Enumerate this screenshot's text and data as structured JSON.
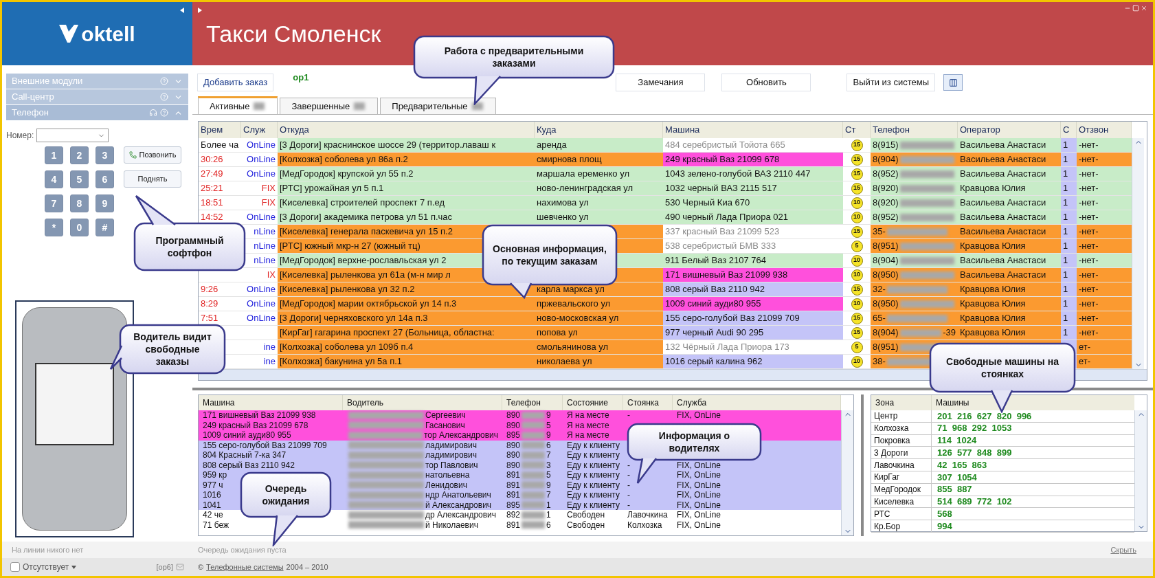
{
  "brand": {
    "logo": "oktell"
  },
  "title_bar": {
    "title": "Такси Смоленск"
  },
  "sidebar": {
    "sections": [
      {
        "label": "Внешние модули",
        "expanded": false
      },
      {
        "label": "Call-центр",
        "expanded": false
      },
      {
        "label": "Телефон",
        "expanded": true
      }
    ]
  },
  "dialer": {
    "number_label": "Номер:",
    "keys": [
      "1",
      "2",
      "3",
      "4",
      "5",
      "6",
      "7",
      "8",
      "9",
      "*",
      "0",
      "#"
    ],
    "call_button": "Позвонить",
    "answer_button": "Поднять"
  },
  "left_status": {
    "line_status": "На линии никого нет",
    "away": {
      "label": "Отсутствует",
      "checked": false
    },
    "operator": "[op6]"
  },
  "toolbar": {
    "add_order": "Добавить заказ",
    "operator": "op1",
    "buttons": [
      "Замечания",
      "Обновить",
      "Выйти из системы"
    ]
  },
  "tabs": [
    {
      "label": "Активные",
      "selected": true
    },
    {
      "label": "Завершенные",
      "selected": false
    },
    {
      "label": "Предварительные",
      "selected": false
    }
  ],
  "orders": {
    "columns": [
      "Врем",
      "Служ",
      "Откуда",
      "Куда",
      "Машина",
      "Ст",
      "Телефон",
      "Оператор",
      "С",
      "Отзвон"
    ],
    "rows": [
      {
        "time": {
          "text": "Более ча",
          "late": false
        },
        "service": {
          "text": "OnLine",
          "color": "#2222dd"
        },
        "route": {
          "from": "[3 Дороги] краснинское шоссе 29 (территор.лаваш к",
          "to": "аренда",
          "color": "#c8ecc8"
        },
        "car": {
          "text": "484 серебристый Тойота 665",
          "dimmed": true,
          "color": "#ffffff"
        },
        "badge": "15",
        "call": {
          "phone": "8(915)",
          "operator": "Васильева Анастаси",
          "recall": "-нет-",
          "color": "#c8ecc8"
        },
        "c": "1"
      },
      {
        "time": {
          "text": "30:26",
          "late": true
        },
        "service": {
          "text": "OnLine",
          "color": "#2222dd"
        },
        "route": {
          "from": "[Колхозка] соболева ул 86а п.2",
          "to": "смирнова площ",
          "color": "#fb9a30"
        },
        "car": {
          "text": "249 красный Ваз 21099 678",
          "dimmed": false,
          "color": "#ff50dc"
        },
        "badge": "15",
        "call": {
          "phone": "8(904)",
          "operator": "Васильева Анастаси",
          "recall": "-нет-",
          "color": "#fb9a30"
        },
        "c": "1"
      },
      {
        "time": {
          "text": "27:49",
          "late": true
        },
        "service": {
          "text": "OnLine",
          "color": "#2222dd"
        },
        "route": {
          "from": "[МедГородок] крупской ул 55 п.2",
          "to": "маршала еременко ул",
          "color": "#c8ecc8"
        },
        "car": {
          "text": "1043 зелено-голубой ВАЗ 2110 447",
          "dimmed": false,
          "color": "#c8ecc8"
        },
        "badge": "15",
        "call": {
          "phone": "8(952)",
          "operator": "Васильева Анастаси",
          "recall": "-нет-",
          "color": "#c8ecc8"
        },
        "c": "1"
      },
      {
        "time": {
          "text": "25:21",
          "late": true
        },
        "service": {
          "text": "FIX",
          "color": "#e02020"
        },
        "route": {
          "from": "[РТС] урожайная ул 5 п.1",
          "to": "ново-ленинградская ул",
          "color": "#c8ecc8"
        },
        "car": {
          "text": "1032 черный ВАЗ 2115 517",
          "dimmed": false,
          "color": "#c8ecc8"
        },
        "badge": "15",
        "call": {
          "phone": "8(920)",
          "operator": "Кравцова Юлия",
          "recall": "-нет-",
          "color": "#c8ecc8"
        },
        "c": "1"
      },
      {
        "time": {
          "text": "18:51",
          "late": true
        },
        "service": {
          "text": "FIX",
          "color": "#e02020"
        },
        "route": {
          "from": "[Киселевка] строителей проспект 7 п.ед",
          "to": "нахимова ул",
          "color": "#c8ecc8"
        },
        "car": {
          "text": "530 Черный Киа 670",
          "dimmed": false,
          "color": "#c8ecc8"
        },
        "badge": "10",
        "call": {
          "phone": "8(920)",
          "operator": "Васильева Анастаси",
          "recall": "-нет-",
          "color": "#c8ecc8"
        },
        "c": "1"
      },
      {
        "time": {
          "text": "14:52",
          "late": true
        },
        "service": {
          "text": "OnLine",
          "color": "#2222dd"
        },
        "route": {
          "from": "[3 Дороги] академика петрова ул 51 п.час",
          "to": "шевченко ул",
          "color": "#c8ecc8"
        },
        "car": {
          "text": "490 черный Лада Приора 021",
          "dimmed": false,
          "color": "#c8ecc8"
        },
        "badge": "10",
        "call": {
          "phone": "8(952)",
          "operator": "Васильева Анастаси",
          "recall": "-нет-",
          "color": "#c8ecc8"
        },
        "c": "1"
      },
      {
        "service": {
          "text": "nLine",
          "color": "#2222dd"
        },
        "route": {
          "from": "[Киселевка] генерала паскевича ул 15 п.2",
          "color": "#fb9a30"
        },
        "car": {
          "text": "337 красный Ваз 21099 523",
          "dimmed": true,
          "color": "#ffffff"
        },
        "badge": "15",
        "call": {
          "phone": "35-",
          "operator": "Васильева Анастаси",
          "recall": "-нет-",
          "color": "#fb9a30"
        },
        "c": "1"
      },
      {
        "service": {
          "text": "nLine",
          "color": "#2222dd"
        },
        "route": {
          "from": "[РТС] южный мкр-н 27 (южный тц)",
          "color": "#fb9a30"
        },
        "car": {
          "text": "538 серебристый БМВ 333",
          "dimmed": true,
          "color": "#ffffff"
        },
        "badge": "5",
        "call": {
          "phone": "8(951)",
          "operator": "Кравцова Юлия",
          "recall": "-нет-",
          "color": "#fb9a30"
        },
        "c": "1"
      },
      {
        "service": {
          "text": "nLine",
          "color": "#2222dd"
        },
        "route": {
          "from": "[МедГородок] верхне-рославльская ул 2",
          "color": "#c8ecc8"
        },
        "car": {
          "text": "911 Белый Ваз 2107 764",
          "dimmed": false,
          "color": "#c8ecc8"
        },
        "badge": "10",
        "call": {
          "phone": "8(904)",
          "operator": "Васильева Анастаси",
          "recall": "-нет-",
          "color": "#c8ecc8"
        },
        "c": "1"
      },
      {
        "service": {
          "text": "IX",
          "color": "#e02020"
        },
        "route": {
          "from": "[Киселевка] рыленкова ул 61а (м-н мир л",
          "color": "#fb9a30"
        },
        "car": {
          "text": "171 вишневый Ваз 21099 938",
          "dimmed": false,
          "color": "#ff50dc"
        },
        "badge": "10",
        "call": {
          "phone": "8(950)",
          "operator": "Васильева Анастаси",
          "recall": "-нет-",
          "color": "#fb9a30"
        },
        "c": "1"
      },
      {
        "time": {
          "text": "9:26",
          "late": true
        },
        "service": {
          "text": "OnLine",
          "color": "#2222dd"
        },
        "route": {
          "from": "[Киселевка] рыленкова ул 32 п.2",
          "to": "карла маркса ул",
          "color": "#fb9a30"
        },
        "car": {
          "text": "808 серый Ваз 2110 942",
          "dimmed": false,
          "color": "#c4c4f8"
        },
        "badge": "15",
        "call": {
          "phone": "32-",
          "operator": "Кравцова Юлия",
          "recall": "-нет-",
          "color": "#fb9a30"
        },
        "c": "1"
      },
      {
        "time": {
          "text": "8:29",
          "late": true
        },
        "service": {
          "text": "OnLine",
          "color": "#2222dd"
        },
        "route": {
          "from": "[МедГородок] марии октябрьской ул 14 п.3",
          "to": "пржевальского ул",
          "color": "#fb9a30"
        },
        "car": {
          "text": "1009 синий ауди80 955",
          "dimmed": false,
          "color": "#ff50dc"
        },
        "badge": "10",
        "call": {
          "phone": "8(950)",
          "operator": "Кравцова Юлия",
          "recall": "-нет-",
          "color": "#fb9a30"
        },
        "c": "1"
      },
      {
        "time": {
          "text": "7:51",
          "late": true
        },
        "service": {
          "text": "OnLine",
          "color": "#2222dd"
        },
        "route": {
          "from": "[3 Дороги] черняховского ул 14а п.3",
          "to": "ново-московская ул",
          "color": "#fb9a30"
        },
        "car": {
          "text": "155 серо-голубой Ваз 21099 709",
          "dimmed": false,
          "color": "#c4c4f8"
        },
        "badge": "15",
        "call": {
          "phone": "65-",
          "operator": "Кравцова Юлия",
          "recall": "-нет-",
          "color": "#fb9a30"
        },
        "c": "1"
      },
      {
        "route": {
          "from": "[КирГаг] гагарина проспект 27 (Больница, областна:",
          "to": "попова ул",
          "color": "#fb9a30"
        },
        "car": {
          "text": "977 черный Audi 90 295",
          "dimmed": false,
          "color": "#c4c4f8"
        },
        "badge": "15",
        "call": {
          "phone": "8(904)",
          "phone_end": "-39",
          "operator": "Кравцова Юлия",
          "recall": "-нет-",
          "color": "#fb9a30"
        },
        "c": "1"
      },
      {
        "service": {
          "text": "ine",
          "color": "#2222dd"
        },
        "route": {
          "from": "[Колхозка] соболева ул 109б п.4",
          "to": "смольянинова ул",
          "color": "#fb9a30"
        },
        "car": {
          "text": "132 Чёрный Лада Приора 173",
          "dimmed": true,
          "color": "#ffffff"
        },
        "badge": "5",
        "call": {
          "phone": "8(951)",
          "recall": "ет-",
          "color": "#fb9a30"
        }
      },
      {
        "service": {
          "text": "ine",
          "color": "#2222dd"
        },
        "route": {
          "from": "[Колхозка] бакунина ул 5а п.1",
          "to": "николаева ул",
          "color": "#fb9a30"
        },
        "car": {
          "text": "1016 серый  калина  962",
          "dimmed": false,
          "color": "#c4c4f8"
        },
        "badge": "10",
        "call": {
          "phone": "38-",
          "recall": "ет-",
          "color": "#fb9a30"
        }
      }
    ]
  },
  "drivers": {
    "columns": [
      "Машина",
      "Водитель",
      "Телефон",
      "Состояние",
      "Стоянка",
      "Служба"
    ],
    "rows": [
      {
        "car": "171 вишневый Ваз 21099 938",
        "driver": "Сергеевич",
        "phone": "890",
        "phone_end": "9",
        "state": "Я на месте",
        "stand": "-",
        "service": "FIX, OnLine",
        "color": "#ff50dc"
      },
      {
        "car": "249 красный Ваз 21099 678",
        "driver": "Гасанович",
        "phone": "890",
        "phone_end": "5",
        "state": "Я на месте",
        "color": "#ff50dc"
      },
      {
        "car": "1009 синий ауди80 955",
        "driver": "тор  Александрович",
        "phone": "895",
        "phone_end": "9",
        "state": "Я на месте",
        "color": "#ff50dc"
      },
      {
        "car": "155 серо-голубой Ваз 21099 709",
        "driver": "ладимирович",
        "phone": "890",
        "phone_end": "6",
        "state": "Еду к клиенту",
        "color": "#c4c4f8"
      },
      {
        "car": "804 Красный 7-ка 347",
        "driver": "ладимирович",
        "phone": "890",
        "phone_end": "7",
        "state": "Еду к клиенту",
        "color": "#c4c4f8"
      },
      {
        "car": "808 серый Ваз 2110 942",
        "driver": "тор Павлович",
        "phone": "890",
        "phone_end": "3",
        "state": "Еду к клиенту",
        "stand": "-",
        "service": "FIX, OnLine",
        "color": "#c4c4f8"
      },
      {
        "car": "959 кр",
        "driver": "натольевна",
        "phone": "891",
        "phone_end": "5",
        "state": "Еду к клиенту",
        "stand": "-",
        "service": "FIX, OnLine",
        "color": "#c4c4f8"
      },
      {
        "car": "977 ч",
        "driver": "Ленидович",
        "phone": "891",
        "phone_end": "9",
        "state": "Еду к клиенту",
        "stand": "-",
        "service": "FIX, OnLine",
        "color": "#c4c4f8"
      },
      {
        "car": "1016",
        "driver": "ндр  Анатольевич",
        "phone": "891",
        "phone_end": "7",
        "state": "Еду к клиенту",
        "stand": "-",
        "service": "FIX, OnLine",
        "color": "#c4c4f8"
      },
      {
        "car": "1041",
        "driver": "й Александрович",
        "phone": "895",
        "phone_end": "1",
        "state": "Еду к клиенту",
        "stand": "-",
        "service": "FIX, OnLine",
        "color": "#c4c4f8"
      },
      {
        "car": "42 че",
        "driver": "др Александрович",
        "phone": "892",
        "phone_end": "1",
        "state": "Свободен",
        "stand": "Лавочкина",
        "service": "FIX, OnLine",
        "color": "#ffffff"
      },
      {
        "car": "71 беж",
        "driver": "й Николаевич",
        "phone": "891",
        "phone_end": "6",
        "state": "Свободен",
        "stand": "Колхозка",
        "service": "FIX, OnLine",
        "color": "#ffffff"
      }
    ]
  },
  "zones": {
    "columns": [
      "Зона",
      "Машины"
    ],
    "rows": [
      {
        "zone": "Центр",
        "cars": "201  216  627  820  996"
      },
      {
        "zone": "Колхозка",
        "cars": "71  968  292  1053"
      },
      {
        "zone": "Покровка",
        "cars": "114  1024"
      },
      {
        "zone": "3 Дороги",
        "cars": "126  577  848  899"
      },
      {
        "zone": "Лавочкина",
        "cars": "42  165  863"
      },
      {
        "zone": "КирГаг",
        "cars": "307  1054"
      },
      {
        "zone": "МедГородок",
        "cars": "855  887"
      },
      {
        "zone": "Киселевка",
        "cars": "514  689  772  102"
      },
      {
        "zone": "РТС",
        "cars": "568"
      },
      {
        "zone": "Кр.Бор",
        "cars": "994"
      }
    ]
  },
  "queue_status": "Очередь ожидания пуста",
  "hide_link": "Скрыть",
  "footer": {
    "copyright": "©",
    "link": "Телефонные системы",
    "years": "2004 – 2010"
  },
  "callouts": [
    {
      "text": "Работа с предварительными заказами"
    },
    {
      "text": "Программный софтфон"
    },
    {
      "text": "Водитель видит свободные заказы"
    },
    {
      "text": "Основная информация, по текущим заказам"
    },
    {
      "text": "Информация о водителях"
    },
    {
      "text": "Очередь ожидания"
    },
    {
      "text": "Свободные машины на стоянках"
    }
  ]
}
